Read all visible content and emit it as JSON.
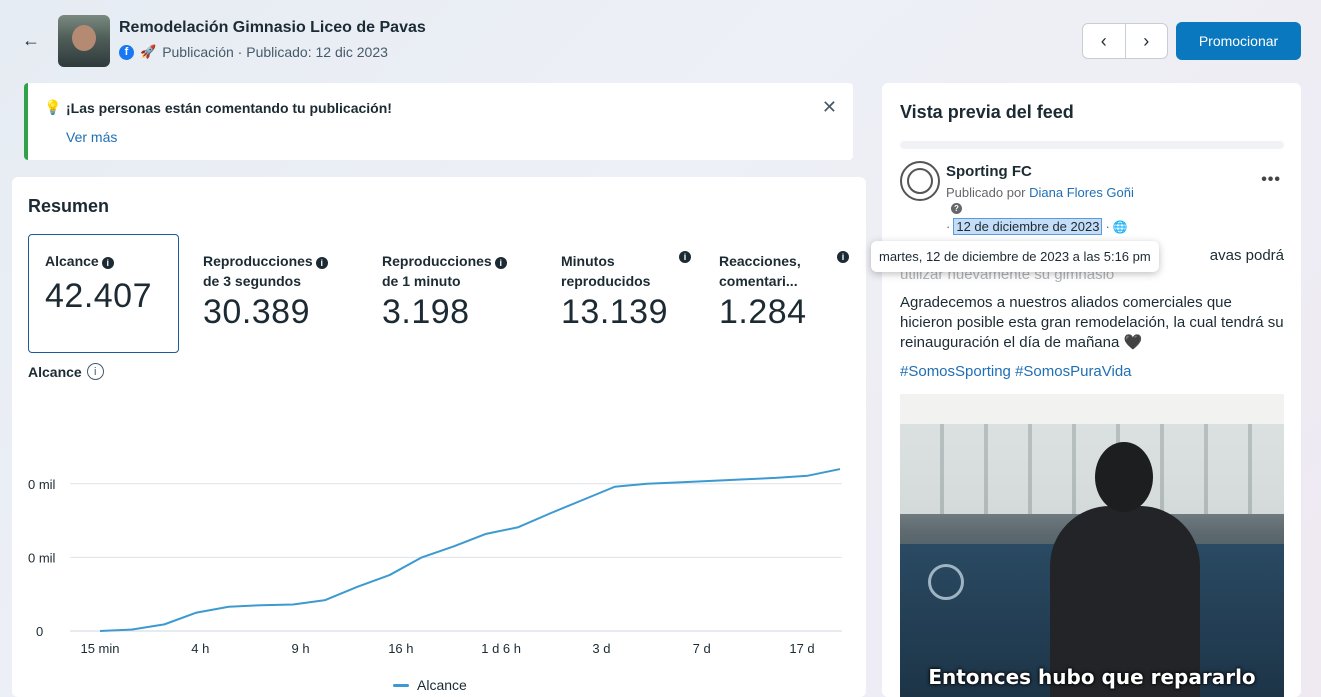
{
  "header": {
    "title": "Remodelación Gimnasio Liceo de Pavas",
    "subtitle": "Publicación · Publicado: 12 dic 2023",
    "promote_label": "Promocionar",
    "prev_label": "‹",
    "next_label": "›"
  },
  "notice": {
    "text": "¡Las personas están comentando tu publicación!",
    "link": "Ver más",
    "close": "✕"
  },
  "summary": {
    "title": "Resumen",
    "metrics": [
      {
        "label": "Alcance",
        "value": "42.407"
      },
      {
        "label": "Reproducciones de 3 segundos",
        "line1": "Reproducciones",
        "line2": "de 3 segundos",
        "value": "30.389"
      },
      {
        "label": "Reproducciones de 1 minuto",
        "line1": "Reproducciones",
        "line2": "de 1 minuto",
        "value": "3.198"
      },
      {
        "label": "Minutos reproducidos",
        "line1": "Minutos",
        "line2": "reproducidos",
        "value": "13.139"
      },
      {
        "label": "Reacciones, comentari...",
        "line1": "Reacciones,",
        "line2": "comentari...",
        "value": "1.284"
      }
    ],
    "chart_title": "Alcance",
    "legend": "Alcance"
  },
  "chart_data": {
    "type": "line",
    "title": "Alcance",
    "x": [
      "15 min",
      "4 h",
      "9 h",
      "16 h",
      "1 d 6 h",
      "3 d",
      "7 d",
      "17 d"
    ],
    "y_tick_labels": [
      "0",
      "0 mil",
      "0 mil"
    ],
    "series": [
      {
        "name": "Alcance",
        "color": "#3d9ad0",
        "values": [
          0,
          0.2,
          0.9,
          2.5,
          3.3,
          3.5,
          3.6,
          4.2,
          6.0,
          7.6,
          10.0,
          11.5,
          13.2,
          14.1,
          16.0,
          17.8,
          19.6,
          20.0,
          20.2,
          20.4,
          20.6,
          20.8,
          21.1,
          22.0
        ]
      }
    ],
    "ylim": [
      0,
      25
    ],
    "grid": true,
    "legend_position": "bottom"
  },
  "feed": {
    "title": "Vista previa del feed",
    "page_name": "Sporting FC",
    "posted_by_prefix": "Publicado por ",
    "author": "Diana Flores Goñi",
    "date": "12 de diciembre de 2023",
    "tooltip": "martes, 12 de diciembre de 2023 a las 5:16 pm",
    "text_line1_tail": "avas podrá",
    "text_line2": "utilizar nuevamente su gimnasio",
    "paragraph": "Agradecemos a nuestros aliados comerciales que hicieron posible esta gran remodelación, la cual tendrá su reinauguración el día de mañana",
    "heart": "🖤",
    "hashtags": "#SomosSporting #SomosPuraVida",
    "image_caption": "Entonces hubo que repararlo"
  },
  "icons": {
    "back": "back-arrow-icon",
    "facebook": "facebook-icon",
    "rocket": "rocket-icon",
    "bulb": "lightbulb-icon",
    "info": "info-icon",
    "globe": "globe-icon",
    "more": "more-options-icon"
  }
}
